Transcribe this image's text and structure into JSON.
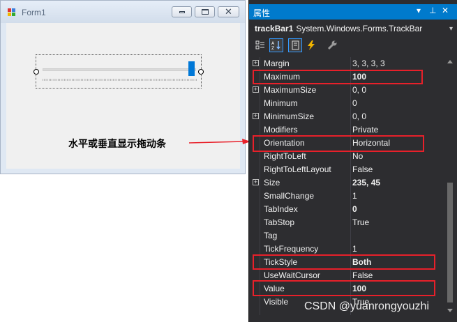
{
  "form": {
    "title": "Form1"
  },
  "annotation": {
    "text": "水平或垂直显示拖动条"
  },
  "properties": {
    "header_title": "属性",
    "object_name": "trackBar1",
    "object_type": "System.Windows.Forms.TrackBar",
    "rows": [
      {
        "name": "Margin",
        "value": "3, 3, 3, 3",
        "expandable": true,
        "bold": false
      },
      {
        "name": "Maximum",
        "value": "100",
        "expandable": false,
        "bold": true
      },
      {
        "name": "MaximumSize",
        "value": "0, 0",
        "expandable": true,
        "bold": false
      },
      {
        "name": "Minimum",
        "value": "0",
        "expandable": false,
        "bold": false
      },
      {
        "name": "MinimumSize",
        "value": "0, 0",
        "expandable": true,
        "bold": false
      },
      {
        "name": "Modifiers",
        "value": "Private",
        "expandable": false,
        "bold": false
      },
      {
        "name": "Orientation",
        "value": "Horizontal",
        "expandable": false,
        "bold": false
      },
      {
        "name": "RightToLeft",
        "value": "No",
        "expandable": false,
        "bold": false
      },
      {
        "name": "RightToLeftLayout",
        "value": "False",
        "expandable": false,
        "bold": false
      },
      {
        "name": "Size",
        "value": "235, 45",
        "expandable": true,
        "bold": true
      },
      {
        "name": "SmallChange",
        "value": "1",
        "expandable": false,
        "bold": false
      },
      {
        "name": "TabIndex",
        "value": "0",
        "expandable": false,
        "bold": true
      },
      {
        "name": "TabStop",
        "value": "True",
        "expandable": false,
        "bold": false
      },
      {
        "name": "Tag",
        "value": "",
        "expandable": false,
        "bold": false
      },
      {
        "name": "TickFrequency",
        "value": "1",
        "expandable": false,
        "bold": false
      },
      {
        "name": "TickStyle",
        "value": "Both",
        "expandable": false,
        "bold": true
      },
      {
        "name": "UseWaitCursor",
        "value": "False",
        "expandable": false,
        "bold": false
      },
      {
        "name": "Value",
        "value": "100",
        "expandable": false,
        "bold": true
      },
      {
        "name": "Visible",
        "value": "True",
        "expandable": false,
        "bold": false
      }
    ]
  },
  "trackbar": {
    "value": 100,
    "maximum": 100
  },
  "watermark": "CSDN @yuanrongyouzhi",
  "colors": {
    "accent": "#007acc",
    "highlight": "#e8202a",
    "thumb": "#0078d7"
  }
}
